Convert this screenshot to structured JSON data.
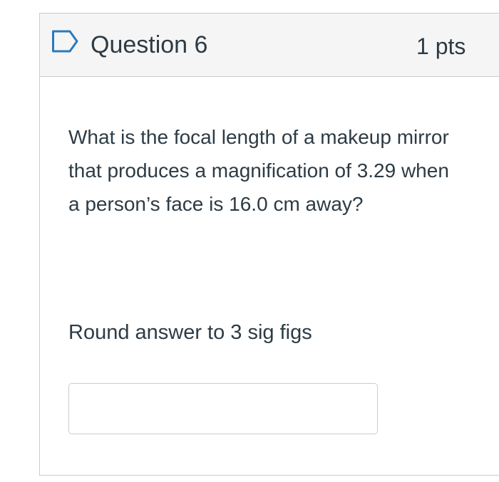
{
  "question": {
    "title": "Question 6",
    "points": "1 pts",
    "flag_icon": "flag-outline-icon",
    "body": "What is the focal length of a makeup mirror that produces a magnification of 3.29 when a person’s face is 16.0 cm away?",
    "instruction": "Round answer to 3 sig figs",
    "answer": {
      "value": "",
      "placeholder": ""
    }
  },
  "colors": {
    "header_background": "#f5f5f5",
    "border": "#c7cdd1",
    "flag_outline": "#2b7abc",
    "text": "#2d3b45"
  }
}
